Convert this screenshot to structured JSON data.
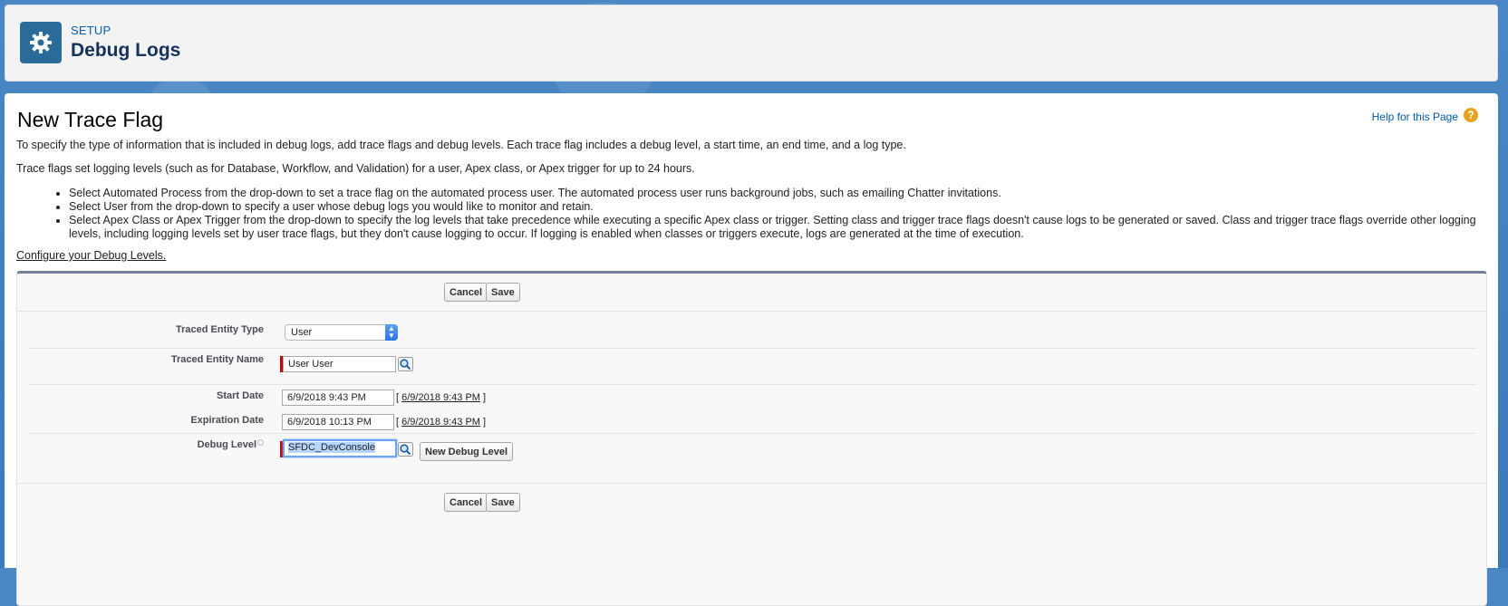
{
  "header": {
    "kicker": "SETUP",
    "title": "Debug Logs",
    "icon": "gear-icon"
  },
  "page": {
    "title": "New Trace Flag",
    "help_link": "Help for this Page",
    "help_icon_glyph": "?",
    "intro_1": "To specify the type of information that is included in debug logs, add trace flags and debug levels. Each trace flag includes a debug level, a start time, an end time, and a log type.",
    "intro_2": "Trace flags set logging levels (such as for Database, Workflow, and Validation) for a user, Apex class, or Apex trigger for up to 24 hours.",
    "bullets": [
      "Select Automated Process from the drop-down to set a trace flag on the automated process user. The automated process user runs background jobs, such as emailing Chatter invitations.",
      "Select User from the drop-down to specify a user whose debug logs you would like to monitor and retain.",
      "Select Apex Class or Apex Trigger from the drop-down to specify the log levels that take precedence while executing a specific Apex class or trigger. Setting class and trigger trace flags doesn't cause logs to be generated or saved. Class and trigger trace flags override other logging levels, including logging levels set by user trace flags, but they don't cause logging to occur. If logging is enabled when classes or triggers execute, logs are generated at the time of execution."
    ],
    "config_link": "Configure your Debug Levels."
  },
  "form": {
    "cancel_label": "Cancel",
    "save_label": "Save",
    "traced_entity_type_label": "Traced Entity Type",
    "traced_entity_type_value": "User",
    "traced_entity_name_label": "Traced Entity Name",
    "traced_entity_name_value": "User User",
    "start_date_label": "Start Date",
    "start_date_value": "6/9/2018 9:43 PM",
    "start_date_link": "6/9/2018 9:43 PM",
    "expiration_date_label": "Expiration Date",
    "expiration_date_value": "6/9/2018 10:13 PM",
    "expiration_date_link": "6/9/2018 9:43 PM",
    "debug_level_label": "Debug Level",
    "debug_level_value": "SFDC_DevConsole",
    "new_debug_level_label": "New Debug Level",
    "bracket_open": "[",
    "bracket_close": "]"
  },
  "colors": {
    "accent_blue": "#2a6b9a",
    "required_red": "#cc0000",
    "link_blue": "#015ba7"
  }
}
